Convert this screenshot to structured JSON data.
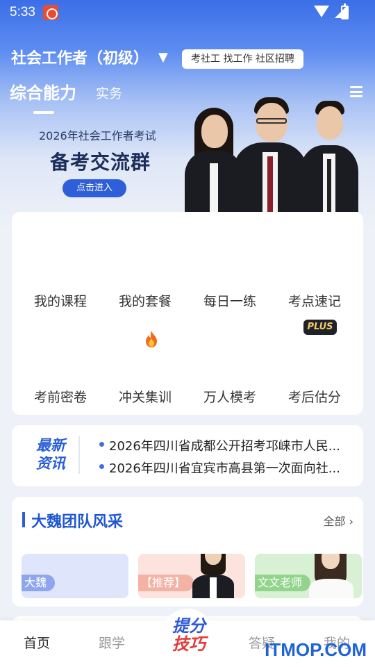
{
  "status_bar": {
    "time": "5:33"
  },
  "header": {
    "title": "社会工作者（初级）",
    "dropdown_icon": "chevron-down-icon",
    "tags": "考社工  找工作  社区招聘"
  },
  "tabs": [
    {
      "label": "综合能力",
      "active": true
    },
    {
      "label": "实务",
      "active": false
    }
  ],
  "banner": {
    "line1": "2026年社会工作者考试",
    "line2": "备考交流群",
    "button": "点击进入"
  },
  "grid": {
    "row1": [
      "我的课程",
      "我的套餐",
      "每日一练",
      "考点速记"
    ],
    "row2": [
      "考前密卷",
      "冲关集训",
      "万人模考",
      "考后估分"
    ],
    "plus_badge": "PLUS"
  },
  "news": {
    "label": "最新资讯",
    "items": [
      "2026年四川省成都公开招考邛崃市人民...",
      "2026年四川省宜宾市高县第一次面向社..."
    ]
  },
  "team": {
    "title": "大魏团队风采",
    "all_label": "全部",
    "teachers": [
      {
        "label": "大魏",
        "bg": "#dfe6fb",
        "tag": "#8fa6ec"
      },
      {
        "label": "【推荐】",
        "bg": "#fce3dd",
        "tag": "#f3b2a4"
      },
      {
        "label": "文文老师",
        "bg": "#d8f1d5",
        "tag": "#92d48c"
      }
    ]
  },
  "bottom_nav": {
    "items": [
      "首页",
      "跟学",
      "答疑",
      "我的"
    ],
    "center_logo_top": "提分",
    "center_logo_bottom": "技巧"
  },
  "watermark": "ITMOP.COM",
  "colors": {
    "primary": "#2f5fd8",
    "accent_red": "#e43b3b"
  }
}
